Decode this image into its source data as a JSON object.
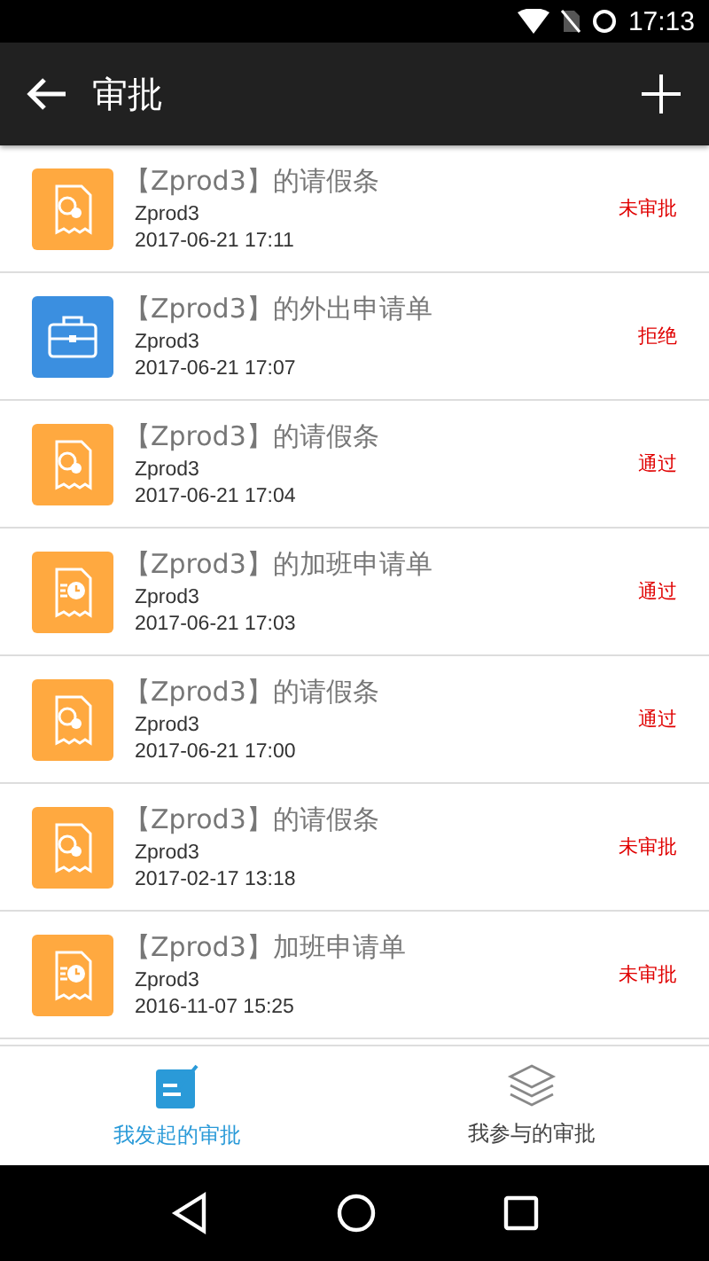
{
  "status_bar": {
    "time": "17:13"
  },
  "app_bar": {
    "title": "审批"
  },
  "items": [
    {
      "kind": "leave",
      "title": "【Zprod3】的请假条",
      "user": "Zprod3",
      "time": "2017-06-21 17:11",
      "status": "未审批"
    },
    {
      "kind": "trip",
      "title": "【Zprod3】的外出申请单",
      "user": "Zprod3",
      "time": "2017-06-21 17:07",
      "status": "拒绝"
    },
    {
      "kind": "leave",
      "title": "【Zprod3】的请假条",
      "user": "Zprod3",
      "time": "2017-06-21 17:04",
      "status": "通过"
    },
    {
      "kind": "overtime",
      "title": "【Zprod3】的加班申请单",
      "user": "Zprod3",
      "time": "2017-06-21 17:03",
      "status": "通过"
    },
    {
      "kind": "leave",
      "title": "【Zprod3】的请假条",
      "user": "Zprod3",
      "time": "2017-06-21 17:00",
      "status": "通过"
    },
    {
      "kind": "leave",
      "title": "【Zprod3】的请假条",
      "user": "Zprod3",
      "time": "2017-02-17 13:18",
      "status": "未审批"
    },
    {
      "kind": "overtime",
      "title": "【Zprod3】加班申请单",
      "user": "Zprod3",
      "time": "2016-11-07 15:25",
      "status": "未审批"
    }
  ],
  "bottom_tabs": [
    {
      "kind": "initiated",
      "label": "我发起的审批",
      "selected": true
    },
    {
      "kind": "participated",
      "label": "我参与的审批",
      "selected": false
    }
  ]
}
